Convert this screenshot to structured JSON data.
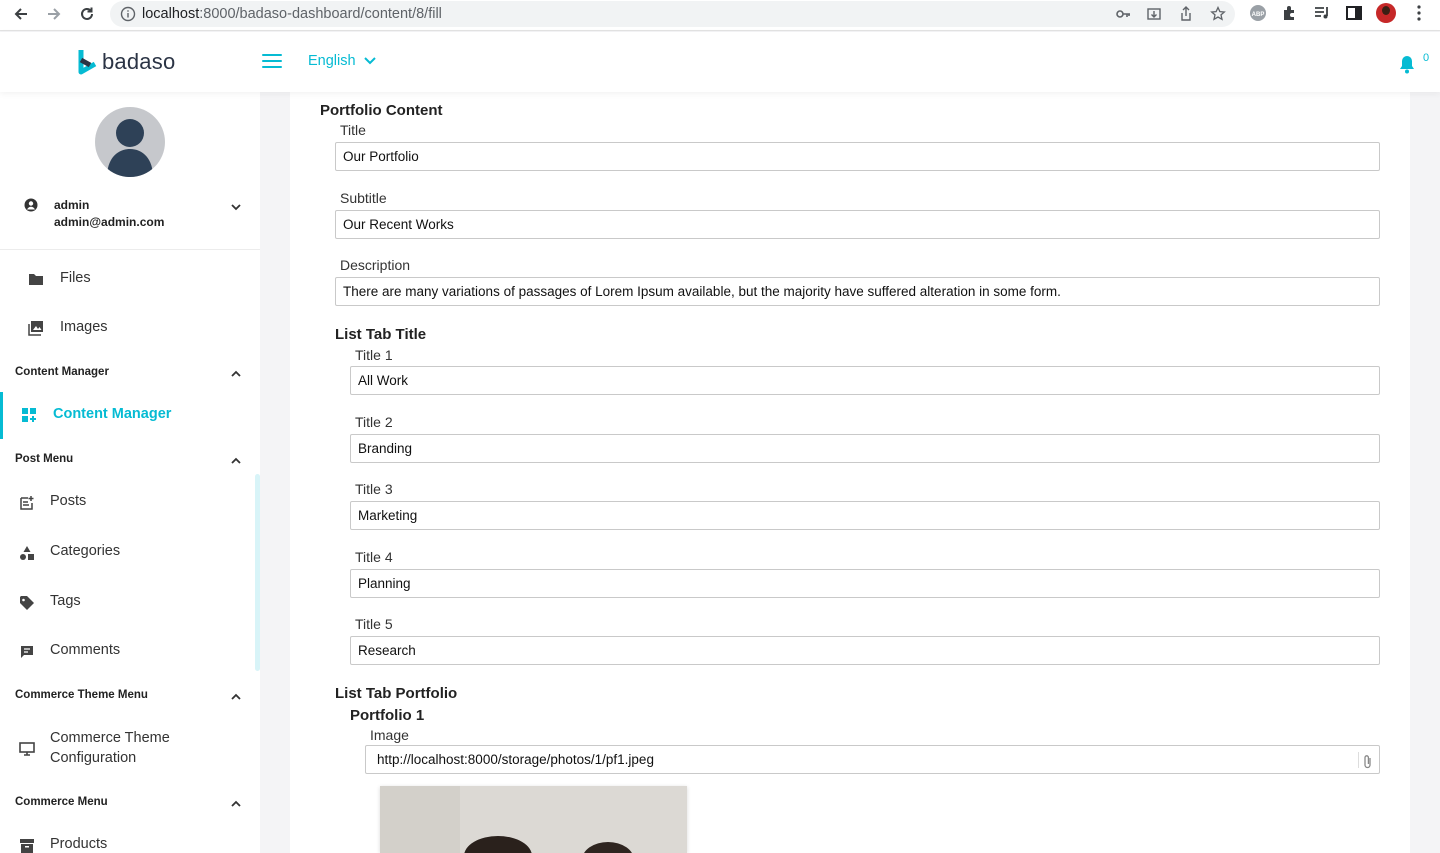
{
  "browser": {
    "url_host": "localhost",
    "url_path": ":8000/badaso-dashboard/content/8/fill"
  },
  "header": {
    "logo_text": "badaso",
    "language": "English",
    "notification_count": "0",
    "accent_color": "#06bbd3"
  },
  "user": {
    "name": "admin",
    "email": "admin@admin.com"
  },
  "sidebar": {
    "files": "Files",
    "images": "Images",
    "group_content_manager": "Content Manager",
    "content_manager": "Content Manager",
    "group_post_menu": "Post Menu",
    "posts": "Posts",
    "categories": "Categories",
    "tags": "Tags",
    "comments": "Comments",
    "group_commerce_theme": "Commerce Theme Menu",
    "commerce_theme_config_line1": "Commerce Theme",
    "commerce_theme_config_line2": "Configuration",
    "group_commerce": "Commerce Menu",
    "products": "Products"
  },
  "main": {
    "section_title": "Portfolio Content",
    "title_label": "Title",
    "title_value": "Our Portfolio",
    "subtitle_label": "Subtitle",
    "subtitle_value": "Our Recent Works",
    "description_label": "Description",
    "description_value": "There are many variations of passages of Lorem Ipsum available, but the majority have suffered alteration in some form.",
    "list_tab_title": "List Tab Title",
    "tabs": [
      {
        "label": "Title 1",
        "value": "All Work"
      },
      {
        "label": "Title 2",
        "value": "Branding"
      },
      {
        "label": "Title 3",
        "value": "Marketing"
      },
      {
        "label": "Title 4",
        "value": "Planning"
      },
      {
        "label": "Title 5",
        "value": "Research"
      }
    ],
    "list_tab_portfolio": "List Tab Portfolio",
    "portfolio_1": "Portfolio 1",
    "image_label": "Image",
    "image_value": "http://localhost:8000/storage/photos/1/pf1.jpeg"
  }
}
